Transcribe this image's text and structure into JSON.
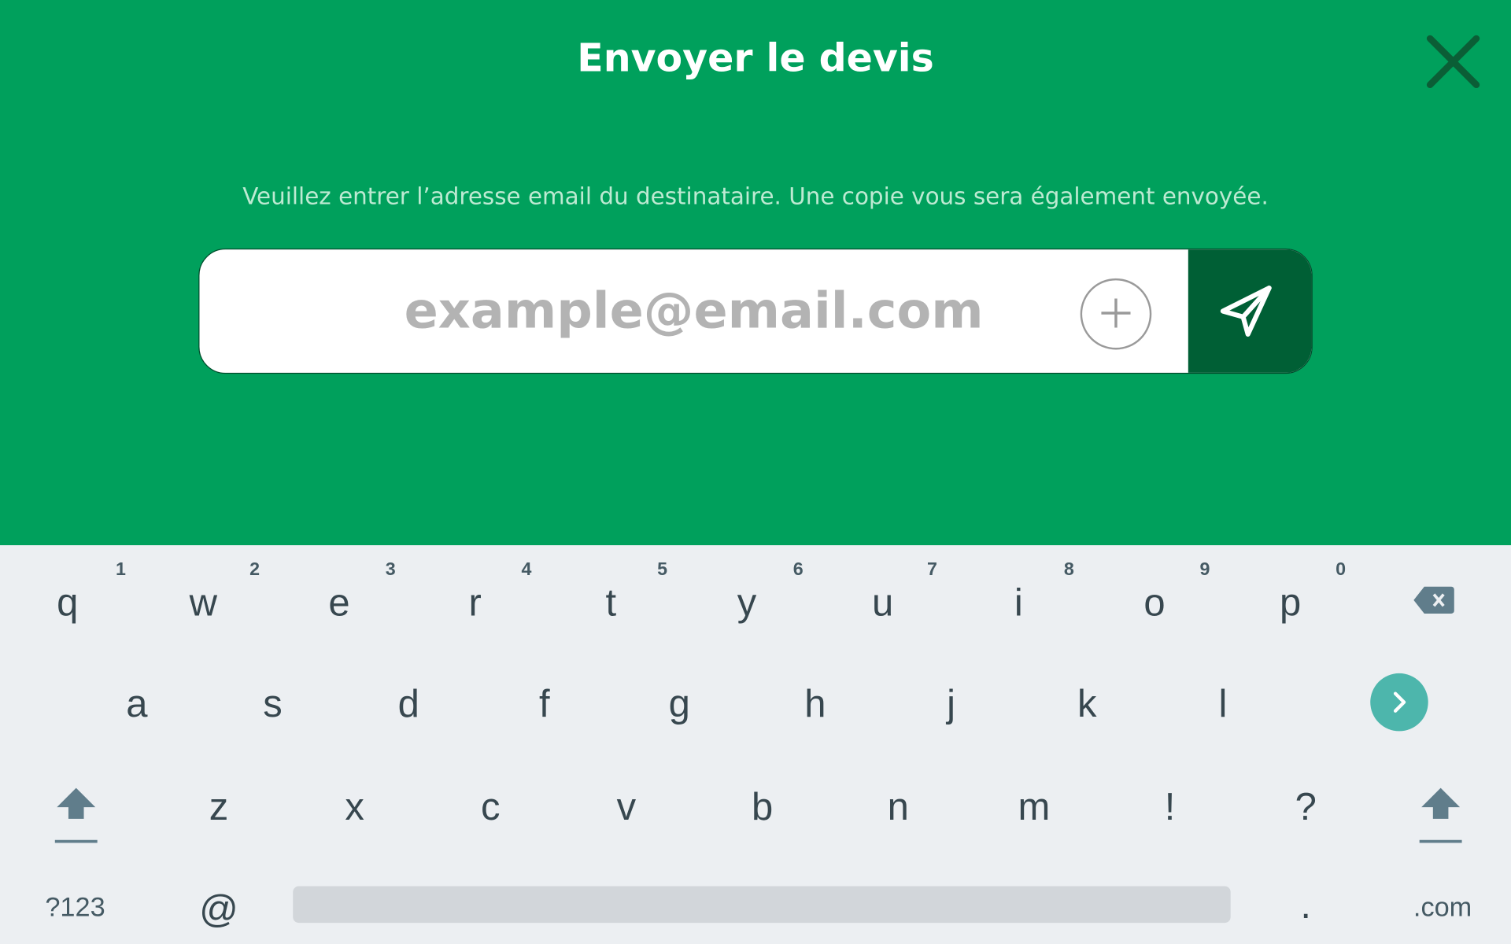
{
  "dialog": {
    "title": "Envoyer le devis",
    "instruction": "Veuillez entrer l’adresse email du destinataire. Une copie vous sera également envoyée.",
    "email_placeholder": "example@email.com",
    "close_icon": "close-icon",
    "add_icon": "plus-circle-icon",
    "send_icon": "paper-plane-icon"
  },
  "keyboard": {
    "row1": [
      {
        "label": "q",
        "hint": "1"
      },
      {
        "label": "w",
        "hint": "2"
      },
      {
        "label": "e",
        "hint": "3"
      },
      {
        "label": "r",
        "hint": "4"
      },
      {
        "label": "t",
        "hint": "5"
      },
      {
        "label": "y",
        "hint": "6"
      },
      {
        "label": "u",
        "hint": "7"
      },
      {
        "label": "i",
        "hint": "8"
      },
      {
        "label": "o",
        "hint": "9"
      },
      {
        "label": "p",
        "hint": "0"
      }
    ],
    "row2": [
      "a",
      "s",
      "d",
      "f",
      "g",
      "h",
      "j",
      "k",
      "l"
    ],
    "row3": [
      "z",
      "x",
      "c",
      "v",
      "b",
      "n",
      "m",
      "!",
      "?"
    ],
    "bottom": {
      "symbols": "?123",
      "at": "@",
      "period": ".",
      "dotcom": ".com"
    },
    "icons": {
      "backspace": "backspace-icon",
      "go": "chevron-right-icon",
      "shift": "shift-icon"
    }
  },
  "colors": {
    "brand_green": "#00A05C",
    "send_button": "#005F35",
    "keyboard_bg": "#ECEFF2",
    "go_button": "#4DB6AC"
  }
}
